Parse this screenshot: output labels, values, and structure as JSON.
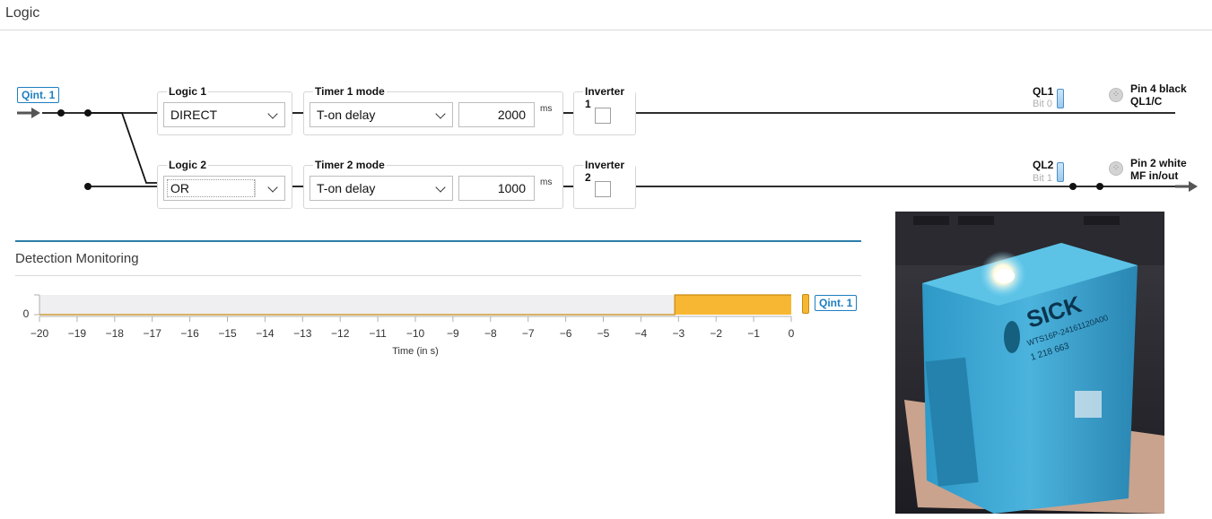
{
  "header": {
    "title": "Logic"
  },
  "input_tag": "Qint. 1",
  "logic1": {
    "label": "Logic 1",
    "value": "DIRECT"
  },
  "timer1": {
    "label": "Timer 1 mode",
    "value": "T-on delay",
    "time": "2000",
    "unit": "ms"
  },
  "inverter1": {
    "label": "Inverter 1",
    "checked": false
  },
  "logic2": {
    "label": "Logic 2",
    "value": "OR"
  },
  "timer2": {
    "label": "Timer 2 mode",
    "value": "T-on delay",
    "time": "1000",
    "unit": "ms"
  },
  "inverter2": {
    "label": "Inverter 2",
    "checked": false
  },
  "output1": {
    "name": "QL1",
    "bit": "Bit 0",
    "pin": "Pin 4 black",
    "signal": "QL1/C"
  },
  "output2": {
    "name": "QL2",
    "bit": "Bit 1",
    "pin": "Pin 2 white",
    "signal": "MF in/out"
  },
  "monitoring": {
    "title": "Detection Monitoring",
    "signal_tag": "Qint. 1"
  },
  "chart_data": {
    "type": "area",
    "title": "",
    "xlabel": "Time (in s)",
    "ylabel": "",
    "xlim": [
      -20,
      0
    ],
    "ytick_labels": [
      "0"
    ],
    "x_ticks": [
      -20,
      -19,
      -18,
      -17,
      -16,
      -15,
      -14,
      -13,
      -12,
      -11,
      -10,
      -9,
      -8,
      -7,
      -6,
      -5,
      -4,
      -3,
      -2,
      -1,
      0
    ],
    "series": [
      {
        "color": "#f7b733",
        "x": [
          -20,
          -3.1,
          -3.1,
          0
        ],
        "y": [
          0,
          0,
          1,
          1
        ]
      }
    ]
  },
  "photo": {
    "brand_text": "SICK",
    "model_text": "WTS16P-24161120A00",
    "code_text": "1 218 663"
  }
}
